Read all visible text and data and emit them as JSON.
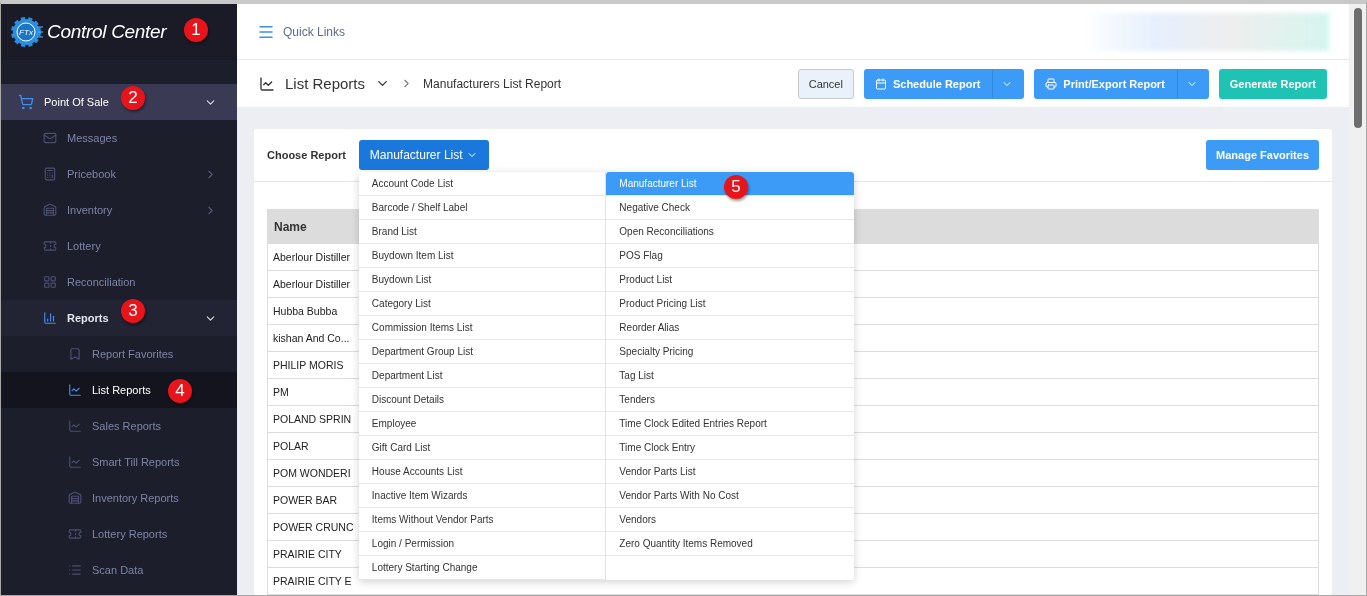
{
  "sidebar": {
    "logo": {
      "badge": "FTx",
      "text": "Control Center"
    },
    "items": [
      {
        "label": "Point Of Sale",
        "selected": true,
        "expanded": true,
        "children": [
          {
            "label": "Messages",
            "selected": false
          },
          {
            "label": "Pricebook",
            "selected": false,
            "expanded": false
          },
          {
            "label": "Inventory",
            "selected": false,
            "expanded": false
          },
          {
            "label": "Lottery",
            "selected": false
          },
          {
            "label": "Reconciliation",
            "selected": false
          },
          {
            "label": "Reports",
            "selected": false,
            "expanded": true,
            "children": [
              {
                "label": "Report Favorites",
                "selected": false
              },
              {
                "label": "List Reports",
                "selected": true
              },
              {
                "label": "Sales Reports",
                "selected": false
              },
              {
                "label": "Smart Till Reports",
                "selected": false
              },
              {
                "label": "Inventory Reports",
                "selected": false
              },
              {
                "label": "Lottery Reports",
                "selected": false
              },
              {
                "label": "Scan Data",
                "selected": false
              }
            ]
          }
        ]
      }
    ]
  },
  "topbar": {
    "quick_links": "Quick Links"
  },
  "breadcrumb": {
    "section": "List Reports",
    "page": "Manufacturers List Report"
  },
  "actions": [
    {
      "label": "Cancel",
      "kind": "plain"
    },
    {
      "label": "Schedule Report",
      "kind": "split"
    },
    {
      "label": "Print/Export Report",
      "kind": "split"
    },
    {
      "label": "Generate Report",
      "kind": "primary"
    }
  ],
  "chooser": {
    "label": "Choose Report",
    "value": "Manufacturer List",
    "manage": "Manage Favorites",
    "options": [
      [
        {
          "label": "Account Code List",
          "selected": false
        },
        {
          "label": "Barcode / Shelf Label",
          "selected": false
        },
        {
          "label": "Brand List",
          "selected": false
        },
        {
          "label": "Buydown Item List",
          "selected": false
        },
        {
          "label": "Buydown List",
          "selected": false
        },
        {
          "label": "Category List",
          "selected": false
        },
        {
          "label": "Commission Items List",
          "selected": false
        },
        {
          "label": "Department Group List",
          "selected": false
        },
        {
          "label": "Department List",
          "selected": false
        },
        {
          "label": "Discount Details",
          "selected": false
        },
        {
          "label": "Employee",
          "selected": false
        },
        {
          "label": "Gift Card List",
          "selected": false
        },
        {
          "label": "House Accounts List",
          "selected": false
        },
        {
          "label": "Inactive Item Wizards",
          "selected": false
        },
        {
          "label": "Items Without Vendor Parts",
          "selected": false
        },
        {
          "label": "Login / Permission",
          "selected": false
        },
        {
          "label": "Lottery Starting Change",
          "selected": false
        }
      ],
      [
        {
          "label": "Manufacturer List",
          "selected": true
        },
        {
          "label": "Negative Check",
          "selected": false
        },
        {
          "label": "Open Reconciliations",
          "selected": false
        },
        {
          "label": "POS Flag",
          "selected": false
        },
        {
          "label": "Product List",
          "selected": false
        },
        {
          "label": "Product Pricing List",
          "selected": false
        },
        {
          "label": "Reorder Alias",
          "selected": false
        },
        {
          "label": "Specialty Pricing",
          "selected": false
        },
        {
          "label": "Tag List",
          "selected": false
        },
        {
          "label": "Tenders",
          "selected": false
        },
        {
          "label": "Time Clock Edited Entries Report",
          "selected": false
        },
        {
          "label": "Time Clock Entry",
          "selected": false
        },
        {
          "label": "Vendor Parts List",
          "selected": false
        },
        {
          "label": "Vendor Parts With No Cost",
          "selected": false
        },
        {
          "label": "Vendors",
          "selected": false
        },
        {
          "label": "Zero Quantity Items Removed",
          "selected": false
        }
      ]
    ]
  },
  "table": {
    "columns": [
      "Name"
    ],
    "rows": [
      "Aberlour Distiller",
      "Aberlour Distiller",
      "Hubba Bubba",
      "kishan And Co...",
      "PHILIP MORIS",
      "PM",
      "POLAND SPRIN",
      "POLAR",
      "POM WONDERI",
      "POWER BAR",
      "POWER CRUNC",
      "PRAIRIE CITY",
      "PRAIRIE CITY E"
    ]
  },
  "annotations": [
    "1",
    "2",
    "3",
    "4",
    "5"
  ]
}
